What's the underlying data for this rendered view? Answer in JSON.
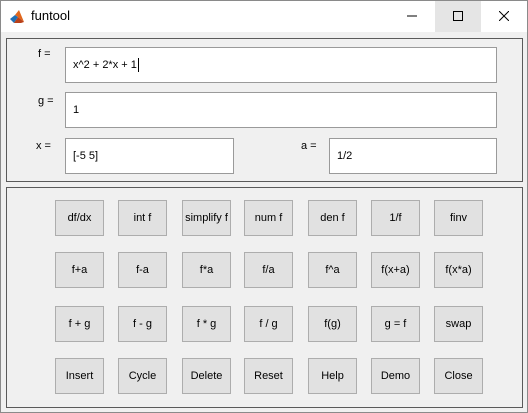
{
  "window": {
    "title": "funtool"
  },
  "fields": {
    "f": {
      "label": "f =",
      "value": "x^2 + 2*x + 1"
    },
    "g": {
      "label": "g =",
      "value": "1"
    },
    "x": {
      "label": "x =",
      "value": "[-5 5]"
    },
    "a": {
      "label": "a =",
      "value": "1/2"
    }
  },
  "buttons": [
    [
      "df/dx",
      "int f",
      "simplify f",
      "num f",
      "den f",
      "1/f",
      "finv"
    ],
    [
      "f+a",
      "f-a",
      "f*a",
      "f/a",
      "f^a",
      "f(x+a)",
      "f(x*a)"
    ],
    [
      "f + g",
      "f - g",
      "f * g",
      "f / g",
      "f(g)",
      "g = f",
      "swap"
    ],
    [
      "Insert",
      "Cycle",
      "Delete",
      "Reset",
      "Help",
      "Demo",
      "Close"
    ]
  ]
}
